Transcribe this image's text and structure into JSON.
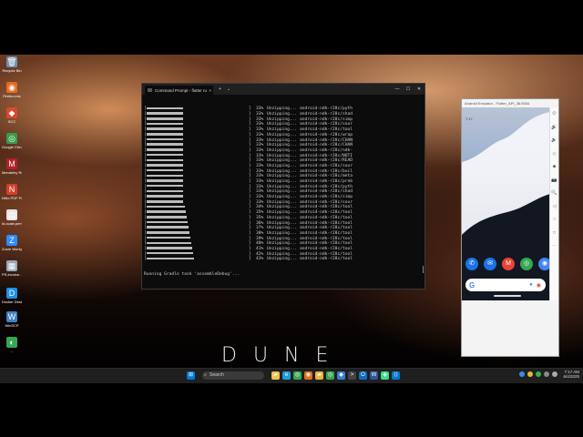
{
  "desktop": {
    "icons": [
      {
        "label": "Recycle Bin",
        "glyph": "🗑",
        "color": "#6f8fb0"
      },
      {
        "label": "Firefox.exe",
        "glyph": "◉",
        "color": "#e76b1f"
      },
      {
        "label": "SCC",
        "glyph": "◆",
        "color": "#d9482c"
      },
      {
        "label": "Google Chrome",
        "glyph": "◎",
        "color": "#3a9b4a"
      },
      {
        "label": "Mendeley Referen...",
        "glyph": "M",
        "color": "#b3202c"
      },
      {
        "label": "Nitro PDF Pro",
        "glyph": "N",
        "color": "#d43e2a"
      },
      {
        "label": "id.ocale.pem",
        "glyph": "▤",
        "color": "#e5e5e5"
      },
      {
        "label": "Zoom Workplace",
        "glyph": "Z",
        "color": "#2d8cff"
      },
      {
        "label": "PS,Invoice... Pictures",
        "glyph": "▦",
        "color": "#9aa7b8"
      },
      {
        "label": "Docker Desktop",
        "glyph": "D",
        "color": "#1d91e6"
      },
      {
        "label": "WinSCP",
        "glyph": "W",
        "color": "#3b82c4"
      },
      {
        "label": "...",
        "glyph": "◐",
        "color": "#33a852"
      }
    ]
  },
  "terminal": {
    "tab_title": "Command Prompt - flutter ru",
    "new_tab": "+",
    "dropdown": "⌄",
    "close_tab": "×",
    "controls": [
      "—",
      "☐",
      "✕"
    ],
    "rows": [
      {
        "fill": 40,
        "pct": "33%",
        "text": "Unzipping... android-ndk-r28c/pyth"
      },
      {
        "fill": 40,
        "pct": "33%",
        "text": "Unzipping... android-ndk-r28c/shad"
      },
      {
        "fill": 40,
        "pct": "33%",
        "text": "Unzipping... android-ndk-r28c/simp"
      },
      {
        "fill": 40,
        "pct": "33%",
        "text": "Unzipping... android-ndk-r28c/sour"
      },
      {
        "fill": 40,
        "pct": "33%",
        "text": "Unzipping... android-ndk-r28c/tool"
      },
      {
        "fill": 40,
        "pct": "33%",
        "text": "Unzipping... android-ndk-r28c/wrap"
      },
      {
        "fill": 40,
        "pct": "33%",
        "text": "Unzipping... android-ndk-r28c/CHAN"
      },
      {
        "fill": 40,
        "pct": "33%",
        "text": "Unzipping... android-ndk-r28c/CHAN"
      },
      {
        "fill": 40,
        "pct": "33%",
        "text": "Unzipping... android-ndk-r28c/ndk-"
      },
      {
        "fill": 40,
        "pct": "33%",
        "text": "Unzipping... android-ndk-r28c/NOTI"
      },
      {
        "fill": 40,
        "pct": "33%",
        "text": "Unzipping... android-ndk-r28c/READ"
      },
      {
        "fill": 40,
        "pct": "33%",
        "text": "Unzipping... android-ndk-r28c/sour"
      },
      {
        "fill": 40,
        "pct": "33%",
        "text": "Unzipping... android-ndk-r28c/buil"
      },
      {
        "fill": 40,
        "pct": "33%",
        "text": "Unzipping... android-ndk-r28c/meta"
      },
      {
        "fill": 40,
        "pct": "33%",
        "text": "Unzipping... android-ndk-r28c/preb"
      },
      {
        "fill": 40,
        "pct": "33%",
        "text": "Unzipping... android-ndk-r28c/pyth"
      },
      {
        "fill": 40,
        "pct": "33%",
        "text": "Unzipping... android-ndk-r28c/shad"
      },
      {
        "fill": 40,
        "pct": "33%",
        "text": "Unzipping... android-ndk-r28c/simp"
      },
      {
        "fill": 40,
        "pct": "33%",
        "text": "Unzipping... android-ndk-r28c/sour"
      },
      {
        "fill": 42,
        "pct": "34%",
        "text": "Unzipping... android-ndk-r28c/tool"
      },
      {
        "fill": 43,
        "pct": "35%",
        "text": "Unzipping... android-ndk-r28c/tool"
      },
      {
        "fill": 44,
        "pct": "35%",
        "text": "Unzipping... android-ndk-r28c/tool"
      },
      {
        "fill": 45,
        "pct": "36%",
        "text": "Unzipping... android-ndk-r28c/tool"
      },
      {
        "fill": 46,
        "pct": "37%",
        "text": "Unzipping... android-ndk-r28c/tool"
      },
      {
        "fill": 47,
        "pct": "38%",
        "text": "Unzipping... android-ndk-r28c/tool"
      },
      {
        "fill": 48,
        "pct": "39%",
        "text": "Unzipping... android-ndk-r28c/tool"
      },
      {
        "fill": 49,
        "pct": "40%",
        "text": "Unzipping... android-ndk-r28c/tool"
      },
      {
        "fill": 50,
        "pct": "41%",
        "text": "Unzipping... android-ndk-r28c/tool"
      },
      {
        "fill": 51,
        "pct": "42%",
        "text": "Unzipping... android-ndk-r28c/tool"
      },
      {
        "fill": 52,
        "pct": "43%",
        "text": "Unzipping... android-ndk-r28c/tool"
      }
    ],
    "status": "Running Gradle task 'assembleDebug'..."
  },
  "emulator": {
    "title": "Android Emulator - Flutter_API_36:5554",
    "time": "7:17",
    "apps": [
      {
        "name": "phone",
        "glyph": "✆",
        "color": "#1a73e8"
      },
      {
        "name": "messages",
        "glyph": "✉",
        "color": "#1a73e8"
      },
      {
        "name": "gmail",
        "glyph": "M",
        "color": "#ea4335"
      },
      {
        "name": "chrome",
        "glyph": "◎",
        "color": "#34a853"
      },
      {
        "name": "camera",
        "glyph": "◉",
        "color": "#4285f4"
      }
    ],
    "search_logo": "G",
    "side_controls": [
      "⏻",
      "🔊",
      "🔉",
      "◇",
      "◆",
      "📷",
      "🔍",
      "◁",
      "○",
      "□",
      "⋯"
    ]
  },
  "wallpaper": {
    "title": "DUNE"
  },
  "taskbar": {
    "search_placeholder": "Search",
    "apps": [
      {
        "name": "file-explorer",
        "glyph": "▰",
        "color": "#f2c14e"
      },
      {
        "name": "edge",
        "glyph": "e",
        "color": "#1f9bd8"
      },
      {
        "name": "chrome",
        "glyph": "◎",
        "color": "#34a853"
      },
      {
        "name": "firefox",
        "glyph": "◉",
        "color": "#e76b1f"
      },
      {
        "name": "folder",
        "glyph": "▰",
        "color": "#e8b73a"
      },
      {
        "name": "chrome-2",
        "glyph": "◎",
        "color": "#34a853"
      },
      {
        "name": "photos",
        "glyph": "◆",
        "color": "#3a7bd5"
      },
      {
        "name": "terminal",
        "glyph": ">",
        "color": "#444444"
      },
      {
        "name": "outlook",
        "glyph": "O",
        "color": "#0f6cbd"
      },
      {
        "name": "word",
        "glyph": "W",
        "color": "#2b579a"
      },
      {
        "name": "android-studio",
        "glyph": "◈",
        "color": "#3ddc84"
      },
      {
        "name": "vscode",
        "glyph": "⟨⟩",
        "color": "#007acc"
      }
    ],
    "time": "7:17 AM",
    "date": "6/4/2025"
  }
}
